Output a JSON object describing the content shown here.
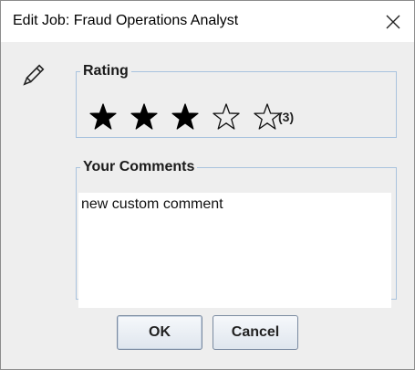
{
  "window": {
    "title": "Edit Job: Fraud Operations Analyst",
    "close_icon": "close-icon"
  },
  "header_icon": "pencil-icon",
  "rating": {
    "label": "Rating",
    "value": 3,
    "max": 5,
    "count_text": "(3)"
  },
  "comments": {
    "label": "Your Comments",
    "value": "new custom comment"
  },
  "buttons": {
    "ok_label": "OK",
    "cancel_label": "Cancel"
  }
}
